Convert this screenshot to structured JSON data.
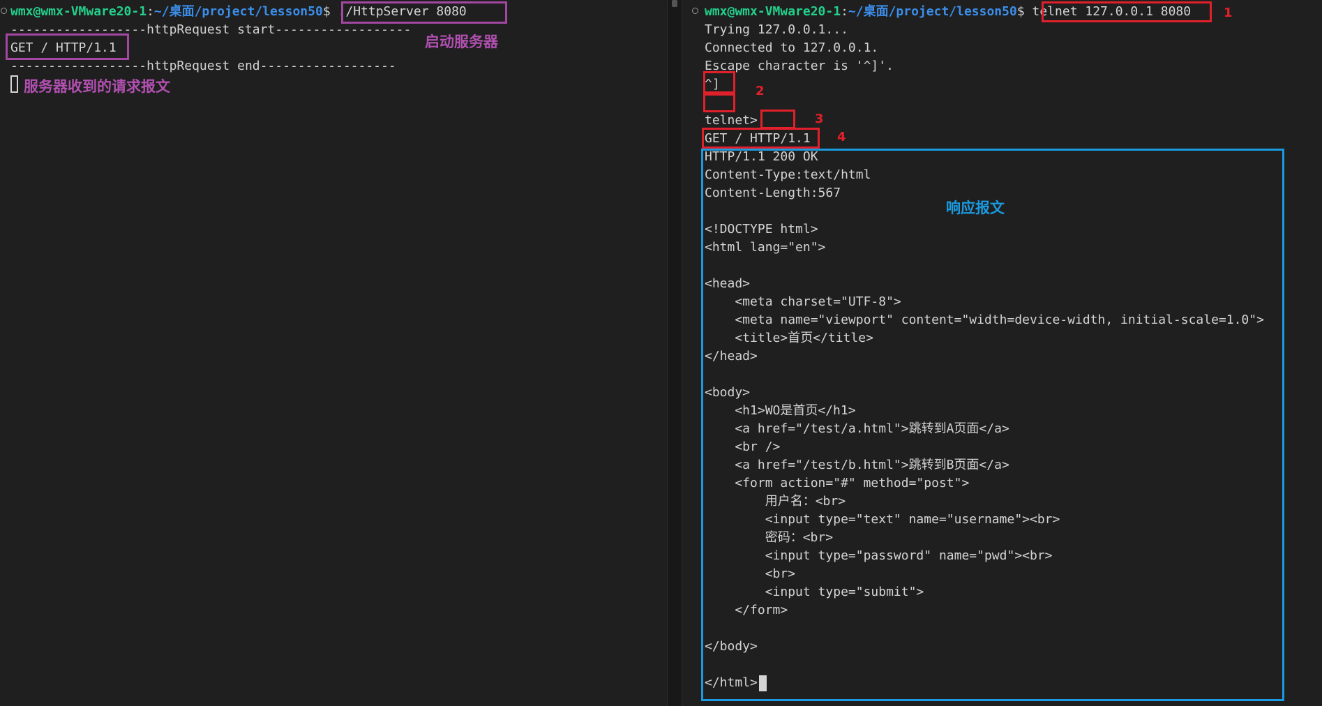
{
  "left": {
    "prompt": {
      "user_host": "wmx@wmx-VMware20-1",
      "colon": ":",
      "path": "~/桌面/project/lesson50",
      "dollar": "$ ",
      "command": "./HttpServer 8080"
    },
    "lines": [
      "------------------httpRequest start------------------",
      "GET / HTTP/1.1",
      "------------------httpRequest end------------------"
    ],
    "annotation_start_server": "启动服务器",
    "annotation_request": "服务器收到的请求报文"
  },
  "right": {
    "prompt": {
      "user_host": "wmx@wmx-VMware20-1",
      "colon": ":",
      "path": "~/桌面/project/lesson50",
      "dollar": "$ ",
      "command": "telnet 127.0.0.1 8080"
    },
    "lines": [
      "Trying 127.0.0.1...",
      "Connected to 127.0.0.1.",
      "Escape character is '^]'.",
      "^]",
      "",
      "telnet>",
      "GET / HTTP/1.1",
      "HTTP/1.1 200 OK",
      "Content-Type:text/html",
      "Content-Length:567",
      "",
      "<!DOCTYPE html>",
      "<html lang=\"en\">",
      "",
      "<head>",
      "    <meta charset=\"UTF-8\">",
      "    <meta name=\"viewport\" content=\"width=device-width, initial-scale=1.0\">",
      "    <title>首页</title>",
      "</head>",
      "",
      "<body>",
      "    <h1>WO是首页</h1>",
      "    <a href=\"/test/a.html\">跳转到A页面</a>",
      "    <br />",
      "    <a href=\"/test/b.html\">跳转到B页面</a>",
      "    <form action=\"#\" method=\"post\">",
      "        用户名：<br>",
      "        <input type=\"text\" name=\"username\"><br>",
      "        密码：<br>",
      "        <input type=\"password\" name=\"pwd\"><br>",
      "        <br>",
      "        <input type=\"submit\">",
      "    </form>",
      "",
      "</body>",
      "",
      "</html>"
    ],
    "annotation_response": "响应报文",
    "step_numbers": [
      "1",
      "2",
      "3",
      "4"
    ]
  },
  "colors": {
    "background": "#1f1f1f",
    "user_host": "#23d18b",
    "path": "#3b8eea",
    "text": "#d4d4d4",
    "annotation_purple": "#a347a3",
    "annotation_red": "#e0202a",
    "annotation_blue": "#1a9ae0"
  }
}
